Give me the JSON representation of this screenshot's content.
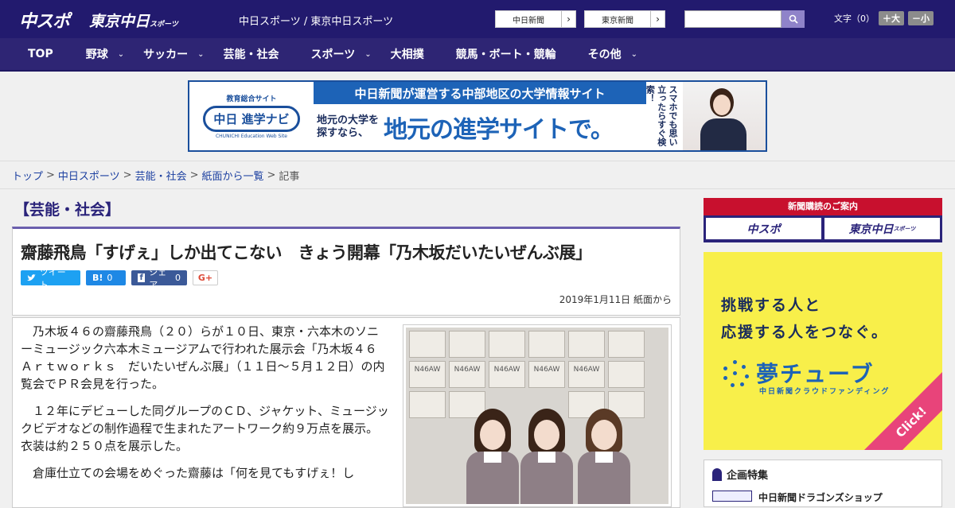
{
  "header": {
    "logo_main": "中スポ",
    "logo_sub": "東京中日",
    "logo_sub_small": "スポーツ",
    "site_links": "中日スポーツ / 東京中日スポーツ",
    "paper_buttons": [
      {
        "label": "中日新聞",
        "arrow": "›"
      },
      {
        "label": "東京新聞",
        "arrow": "›"
      }
    ],
    "search_placeholder": "",
    "font_size": {
      "label": "文字（0）",
      "plus": "＋大",
      "minus": "－小"
    }
  },
  "nav": {
    "items": [
      {
        "label": "TOP",
        "has_menu": false
      },
      {
        "label": "野球",
        "has_menu": true
      },
      {
        "label": "サッカー",
        "has_menu": true
      },
      {
        "label": "芸能・社会",
        "has_menu": false
      },
      {
        "label": "スポーツ",
        "has_menu": true
      },
      {
        "label": "大相撲",
        "has_menu": false
      },
      {
        "label": "競馬・ボート・競輪",
        "has_menu": false
      },
      {
        "label": "その他",
        "has_menu": true
      }
    ],
    "chevron": "⌄"
  },
  "banner": {
    "sub": "教育総合サイト",
    "logo": "中日 進学ナビ",
    "eng": "CHUNICHI Education Web Site",
    "top_text": "中日新聞が運営する中部地区の大学情報サイト",
    "small_text_1": "地元の大学を",
    "small_text_2": "探すなら、",
    "big_text": "地元の進学サイトで。",
    "vertical_text": "スマホでも思い立ったらすぐ検索！"
  },
  "breadcrumb": {
    "links": [
      "トップ",
      "中日スポーツ",
      "芸能・社会",
      "紙面から一覧"
    ],
    "current": "記事",
    "separator": ">"
  },
  "article": {
    "category": "【芸能・社会】",
    "headline": "齋藤飛鳥「すげぇ」しか出てこない　きょう開幕「乃木坂だいたいぜんぶ展」",
    "share": {
      "tweet": "ツイート",
      "hatena": "B!",
      "hatena_count": "0",
      "facebook": "シェア",
      "facebook_count": "0",
      "gplus": "G+"
    },
    "date": "2019年1月11日 紙面から",
    "paragraphs": [
      "乃木坂４６の齋藤飛鳥（２０）らが１０日、東京・六本木のソニーミュージック六本木ミュージアムで行われた展示会「乃木坂４６　Ａｒｔｗｏｒｋｓ　だいたいぜんぶ展」（１１日～５月１２日）の内覧会でＰＲ会見を行った。",
      "１２年にデビューした同グループのＣＤ、ジャケット、ミュージックビデオなどの制作過程で生まれたアートワーク約９万点を展示。衣装は約２５０点を展示した。",
      "倉庫仕立ての会場をめぐった齋藤は「何を見てもすげぇ！し"
    ],
    "photo_box_label": "N46AW"
  },
  "sidebar": {
    "subscribe_title": "新聞購読のご案内",
    "subscribe_logos": [
      "中スポ",
      "東京中日"
    ],
    "subscribe_logo_small": "スポーツ",
    "yume_copy_1": "挑戦する人と",
    "yume_copy_2": "応援する人をつなぐ。",
    "yume_name": "夢チューブ",
    "yume_sub": "中日新聞クラウドファンディング",
    "yume_click": "Click!",
    "feature_title": "企画特集",
    "feature_item": "中日新聞ドラゴンズショップ"
  },
  "colors": {
    "header_bg": "#221a6e",
    "nav_bg": "#2e2574",
    "accent": "#6b5fad",
    "link": "#1b3fa0",
    "subscribe_red": "#c8102e"
  }
}
